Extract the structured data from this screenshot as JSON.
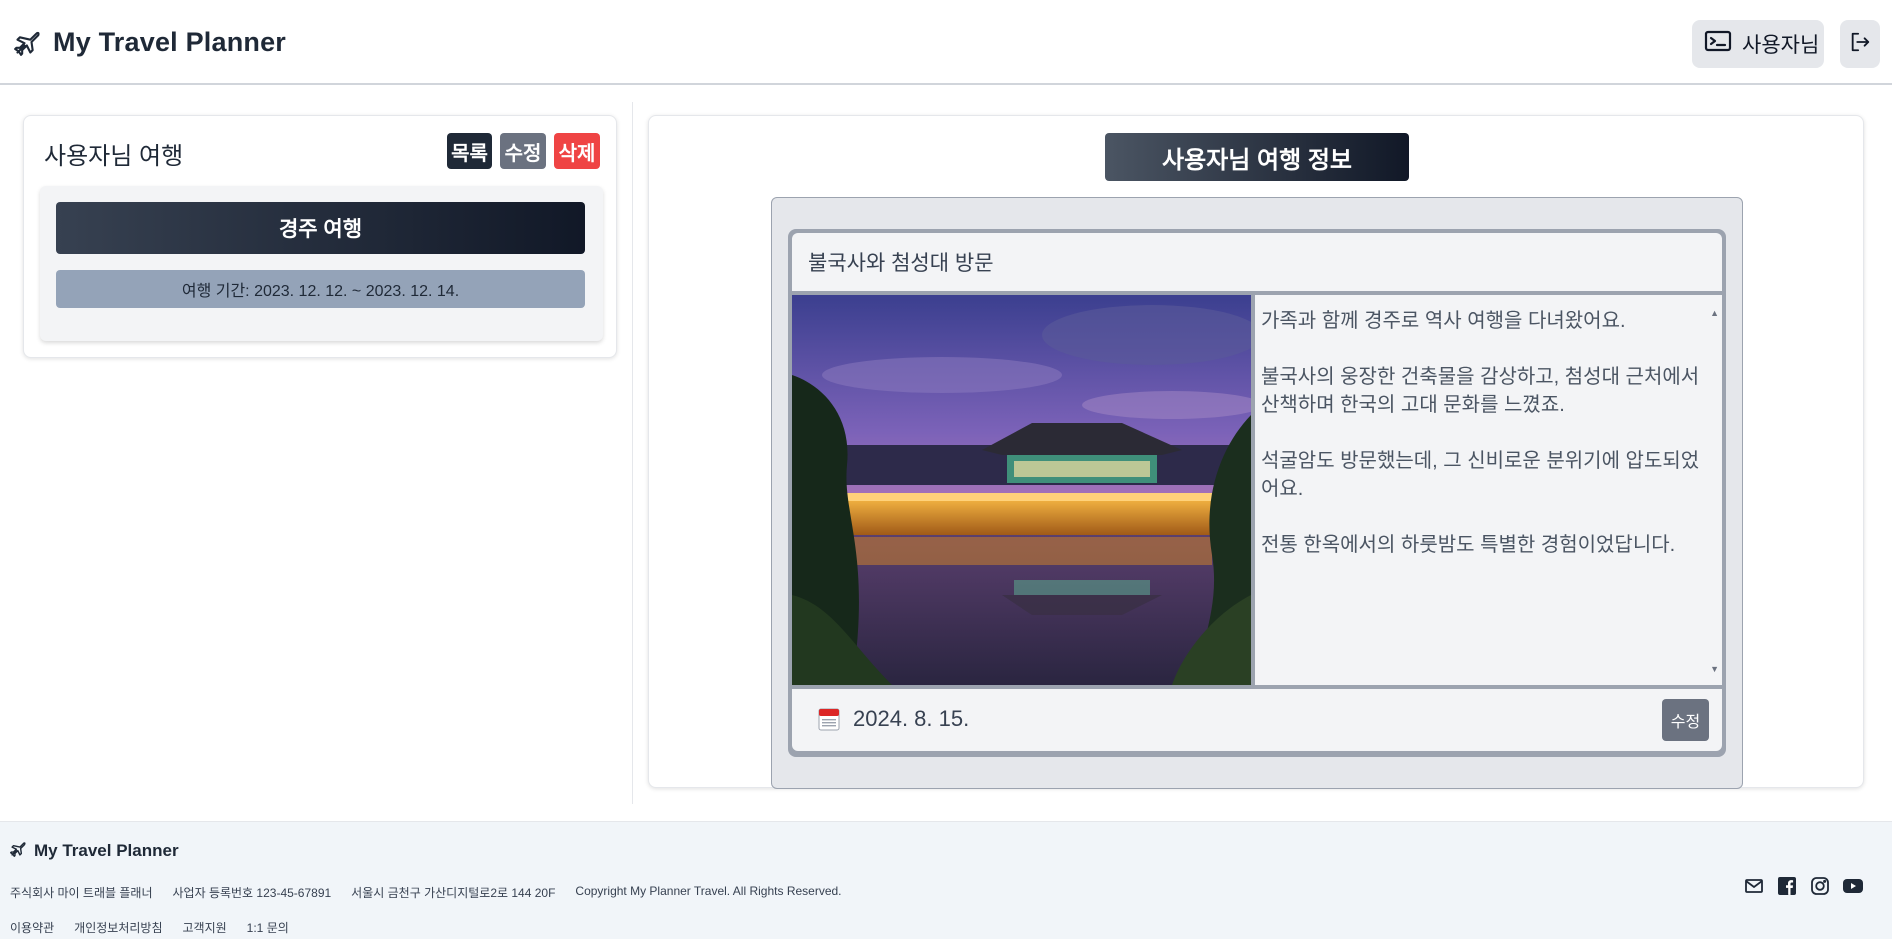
{
  "header": {
    "brand": "My Travel Planner",
    "user_button": "사용자님",
    "icons": {
      "brand": "airplane-icon",
      "user": "terminal-icon",
      "logout": "logout-icon"
    }
  },
  "sidebar": {
    "title": "사용자님 여행",
    "buttons": {
      "list": "목록",
      "edit": "수정",
      "delete": "삭제"
    },
    "trip": {
      "name": "경주 여행",
      "period": "여행 기간: 2023. 12. 12. ~ 2023. 12. 14."
    }
  },
  "main": {
    "title": "사용자님 여행 정보",
    "post": {
      "subject": "불국사와 첨성대 방문",
      "paragraphs": [
        "가족과 함께 경주로 역사 여행을 다녀왔어요.",
        "불국사의 웅장한 건축물을 감상하고, 첨성대 근처에서 산책하며 한국의 고대 문화를 느꼈죠.",
        "석굴암도 방문했는데, 그 신비로운 분위기에 압도되었어요.",
        "전통 한옥에서의 하룻밤도 특별한 경험이었답니다."
      ],
      "date": "2024. 8. 15.",
      "edit_button": "수정",
      "photo_icon": "night-palace-photo",
      "date_icon": "calendar-icon"
    }
  },
  "footer": {
    "brand": "My Travel Planner",
    "company": "주식회사 마이 트래블 플래너",
    "registration": "사업자 등록번호 123-45-67891",
    "address": "서울시 금천구 가산디지털로2로 144 20F",
    "copyright": "Copyright My Planner Travel. All Rights Reserved.",
    "links": [
      "이용약관",
      "개인정보처리방침",
      "고객지원",
      "1:1 문의"
    ],
    "social_icons": [
      "mail-icon",
      "facebook-icon",
      "instagram-icon",
      "youtube-icon"
    ]
  }
}
